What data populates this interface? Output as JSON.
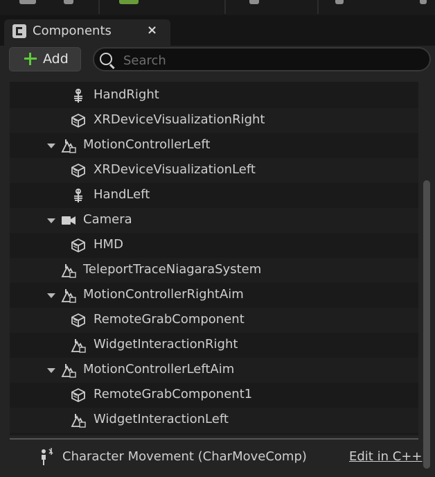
{
  "tab": {
    "title": "Components",
    "close": "×"
  },
  "toolbar": {
    "add_label": "Add"
  },
  "search": {
    "placeholder": "Search",
    "value": ""
  },
  "tree": {
    "items": [
      {
        "label": "HandRight",
        "icon": "skeleton-icon",
        "indent": 2,
        "expandable": false
      },
      {
        "label": "XRDeviceVisualizationRight",
        "icon": "cube-icon",
        "indent": 2,
        "expandable": false
      },
      {
        "label": "MotionControllerLeft",
        "icon": "scene-component-icon",
        "indent": 1,
        "expandable": true
      },
      {
        "label": "XRDeviceVisualizationLeft",
        "icon": "cube-icon",
        "indent": 2,
        "expandable": false
      },
      {
        "label": "HandLeft",
        "icon": "skeleton-icon",
        "indent": 2,
        "expandable": false
      },
      {
        "label": "Camera",
        "icon": "camera-icon",
        "indent": 1,
        "expandable": true
      },
      {
        "label": "HMD",
        "icon": "cube-icon",
        "indent": 2,
        "expandable": false
      },
      {
        "label": "TeleportTraceNiagaraSystem",
        "icon": "scene-component-icon",
        "indent": 1,
        "expandable": false
      },
      {
        "label": "MotionControllerRightAim",
        "icon": "scene-component-icon",
        "indent": 1,
        "expandable": true
      },
      {
        "label": "RemoteGrabComponent",
        "icon": "cube-icon",
        "indent": 2,
        "expandable": false
      },
      {
        "label": "WidgetInteractionRight",
        "icon": "scene-component-icon",
        "indent": 2,
        "expandable": false
      },
      {
        "label": "MotionControllerLeftAim",
        "icon": "scene-component-icon",
        "indent": 1,
        "expandable": true
      },
      {
        "label": "RemoteGrabComponent1",
        "icon": "cube-icon",
        "indent": 2,
        "expandable": false
      },
      {
        "label": "WidgetInteractionLeft",
        "icon": "scene-component-icon",
        "indent": 2,
        "expandable": false
      }
    ]
  },
  "footer": {
    "component_label": "Character Movement (CharMoveComp)",
    "edit_link": "Edit in C++",
    "icon": "character-movement-icon"
  },
  "colors": {
    "accent_green": "#5ecb3a",
    "panel_bg": "#242424",
    "tree_bg": "#1a1a1a"
  }
}
